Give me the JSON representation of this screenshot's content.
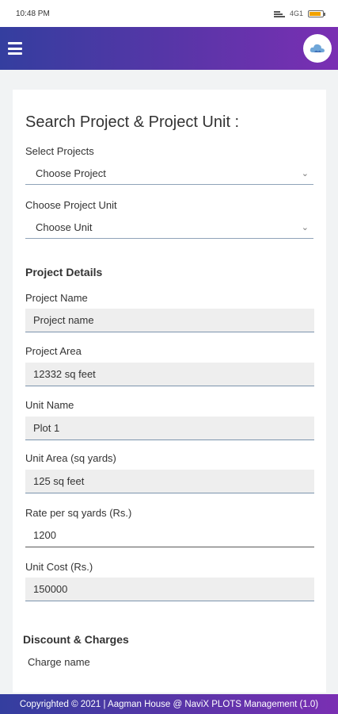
{
  "status_bar": {
    "time": "10:48 PM",
    "network": "4G1",
    "battery_level": 0.75,
    "battery_color": "#f2a300"
  },
  "app_bar": {
    "menu_icon": "hamburger-icon",
    "logo_icon": "cloud-logo-icon",
    "gradient_start": "#343e9f",
    "gradient_end": "#7a2fb3"
  },
  "search": {
    "heading": "Search Project & Project Unit :",
    "project_label": "Select Projects",
    "project_value": "Choose Project",
    "unit_label": "Choose Project Unit",
    "unit_value": "Choose Unit"
  },
  "details": {
    "title": "Project Details",
    "project_name_label": "Project Name",
    "project_name_value": "Project name",
    "project_area_label": "Project Area",
    "project_area_value": "12332 sq feet",
    "unit_name_label": "Unit Name",
    "unit_name_value": "Plot 1",
    "unit_area_label": "Unit Area (sq yards)",
    "unit_area_value": "125 sq feet",
    "rate_label": "Rate per sq yards (Rs.)",
    "rate_value": "1200",
    "unit_cost_label": "Unit Cost (Rs.)",
    "unit_cost_value": "150000"
  },
  "discount": {
    "title": "Discount & Charges",
    "charge_name_label": "Charge name"
  },
  "footer": {
    "text": "Copyrighted © 2021 | Aagman House @ NaviX PLOTS Management (1.0)"
  }
}
